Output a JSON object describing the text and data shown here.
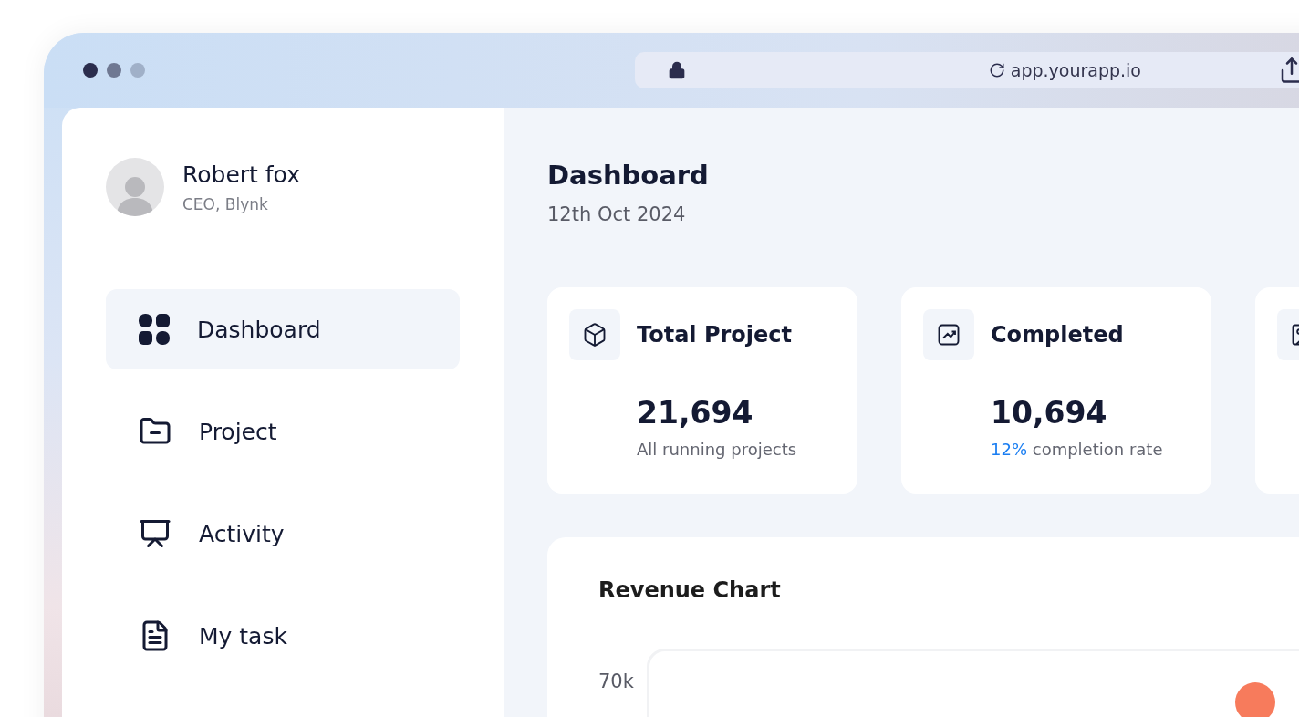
{
  "browser": {
    "url": "app.yourapp.io"
  },
  "user": {
    "name": "Robert fox",
    "role": "CEO, Blynk"
  },
  "nav": [
    {
      "label": "Dashboard",
      "selected": true
    },
    {
      "label": "Project",
      "selected": false
    },
    {
      "label": "Activity",
      "selected": false
    },
    {
      "label": "My task",
      "selected": false
    }
  ],
  "header": {
    "title": "Dashboard",
    "date": "12th Oct 2024"
  },
  "stats": [
    {
      "title": "Total Project",
      "value": "21,694",
      "note": "All running projects"
    },
    {
      "title": "Completed",
      "value": "10,694",
      "highlight": "12%",
      "note": "completion rate"
    }
  ],
  "revenue": {
    "title": "Revenue Chart",
    "y_tick": "70k"
  }
}
